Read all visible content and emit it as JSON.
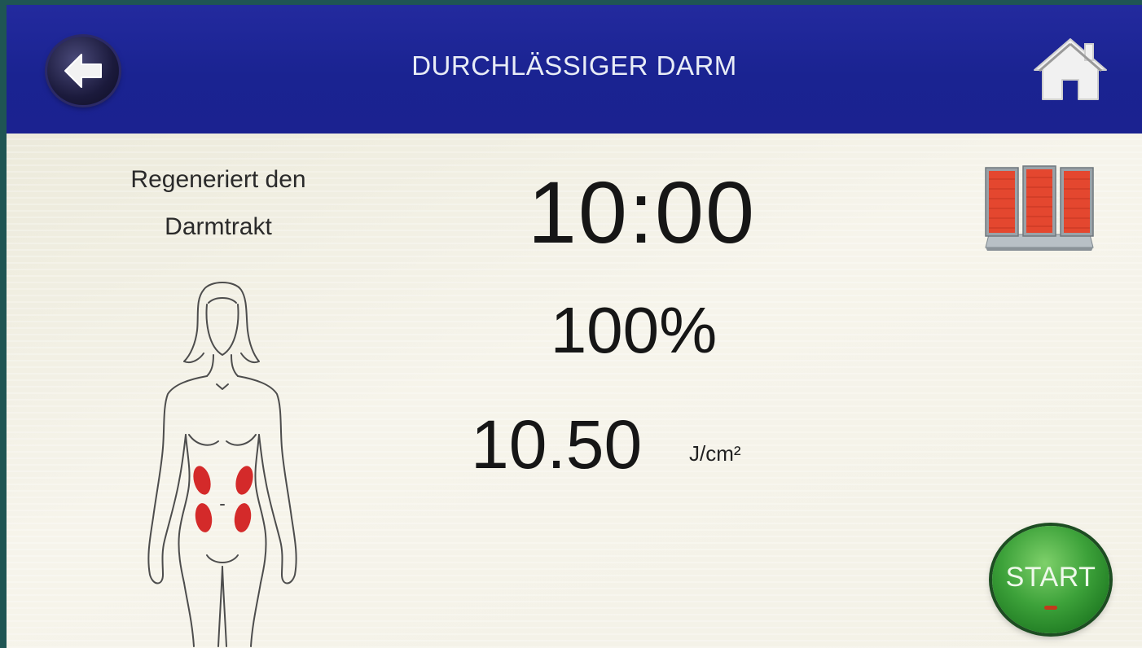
{
  "header": {
    "title": "DURCHLÄSSIGER DARM",
    "back_icon": "arrow-left-icon",
    "home_icon": "home-icon"
  },
  "program": {
    "description_line1": "Regeneriert den",
    "description_line2": "Darmtrakt",
    "figure_icon": "female-body-outline-icon",
    "treatment_area_color": "#d42a2a"
  },
  "readouts": {
    "time": "10:00",
    "intensity": "100%",
    "dose_value": "10.50",
    "dose_unit": "J/cm²"
  },
  "device": {
    "icon": "red-light-panel-icon",
    "panel_color": "#e4472f"
  },
  "controls": {
    "start_label": "START",
    "start_color": "#3da23a"
  },
  "colors": {
    "header_bg": "#1a2391",
    "content_bg": "#f4f1e6",
    "frame_bg": "#1f5553"
  }
}
